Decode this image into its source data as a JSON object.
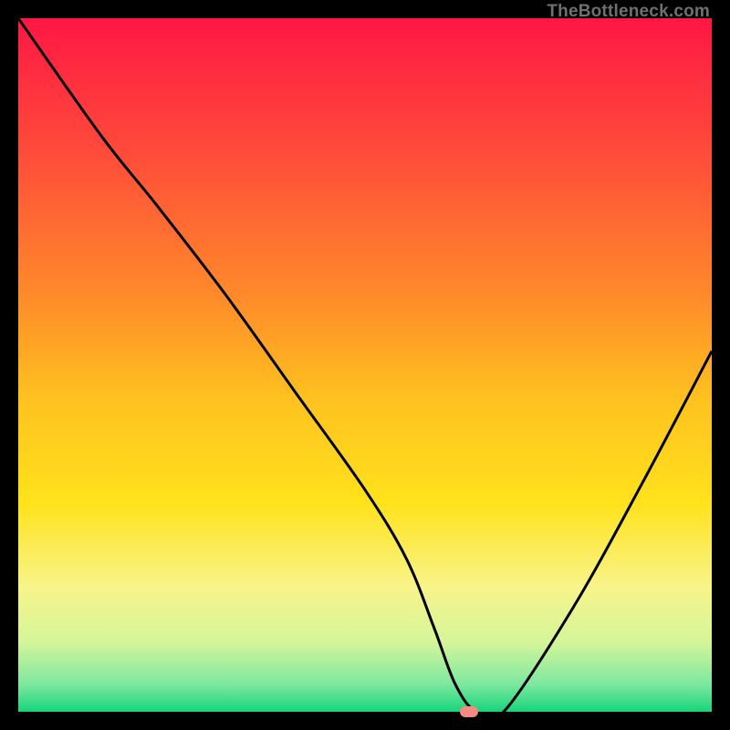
{
  "watermark": "TheBottleneck.com",
  "chart_data": {
    "type": "line",
    "title": "",
    "xlabel": "",
    "ylabel": "",
    "xlim": [
      0,
      100
    ],
    "ylim": [
      0,
      100
    ],
    "grid": false,
    "legend": false,
    "gradient_stops": [
      {
        "offset": 0.0,
        "color": "#ff1744"
      },
      {
        "offset": 0.2,
        "color": "#ff4d3a"
      },
      {
        "offset": 0.4,
        "color": "#ff8a2a"
      },
      {
        "offset": 0.55,
        "color": "#ffc21f"
      },
      {
        "offset": 0.7,
        "color": "#ffe21c"
      },
      {
        "offset": 0.82,
        "color": "#f8f48a"
      },
      {
        "offset": 0.9,
        "color": "#d4f59a"
      },
      {
        "offset": 0.96,
        "color": "#7ee8a0"
      },
      {
        "offset": 1.0,
        "color": "#17d47a"
      }
    ],
    "series": [
      {
        "name": "bottleneck-curve",
        "x": [
          0,
          12,
          20,
          30,
          40,
          50,
          56,
          60,
          63,
          66,
          70,
          80,
          90,
          100
        ],
        "values": [
          100,
          83,
          73,
          60,
          46,
          32,
          22,
          12,
          4,
          0,
          0,
          15,
          33,
          52
        ]
      }
    ],
    "marker": {
      "x": 65,
      "y": 0,
      "color": "#f48a80"
    }
  }
}
